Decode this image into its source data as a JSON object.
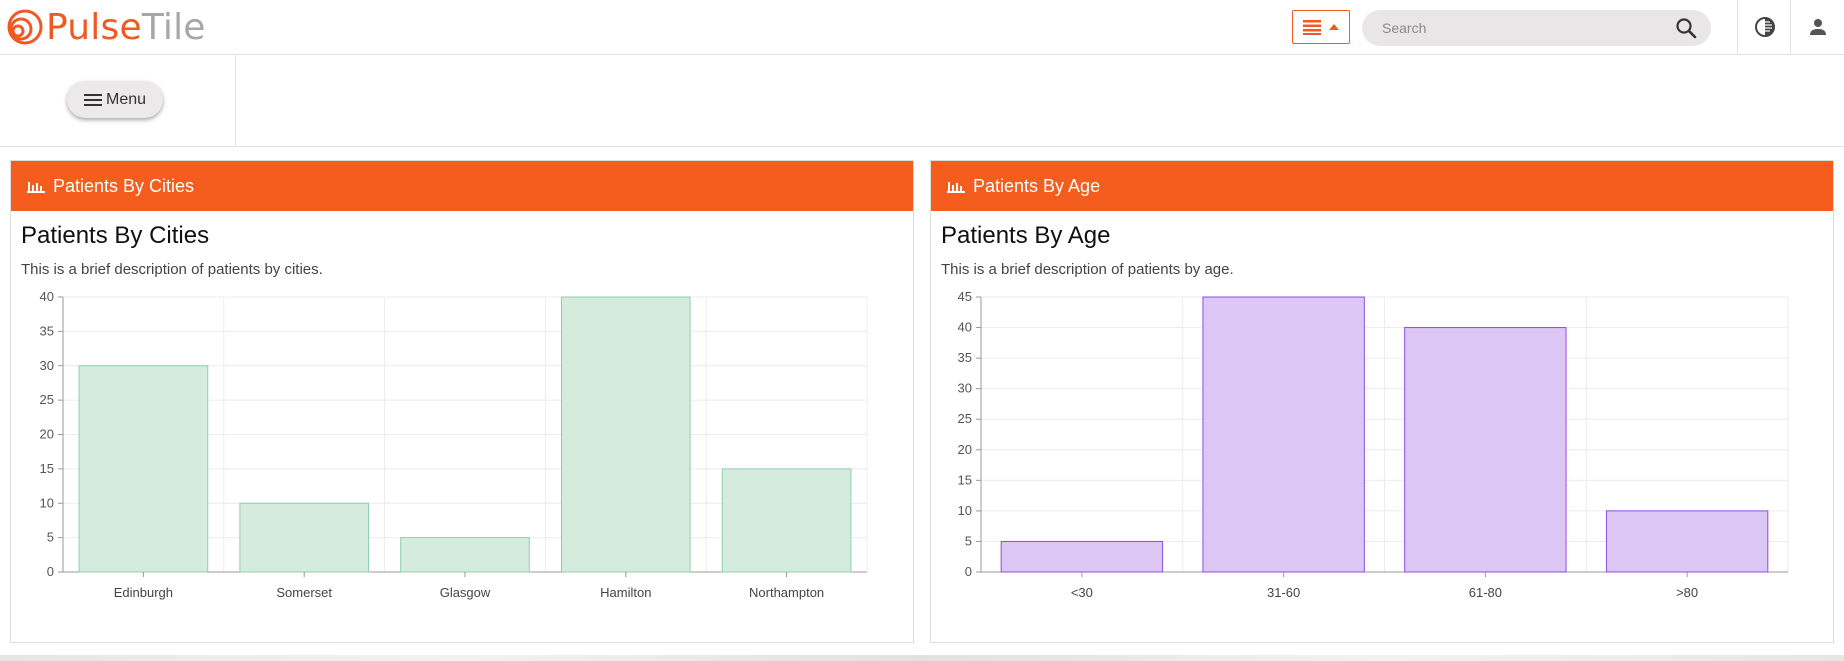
{
  "header": {
    "logo_text_1": "Pulse",
    "logo_text_2": "Tile",
    "search_placeholder": "Search",
    "nav_toggle_icon": "list-icon",
    "theme_icon": "contrast-icon",
    "user_icon": "person-icon"
  },
  "subbar": {
    "menu_label": "Menu"
  },
  "colors": {
    "brand": "#f05a22",
    "panel_header": "#f55d1f",
    "cities_bar_fill": "#d4ebde",
    "cities_bar_stroke": "#8fd0ad",
    "age_bar_fill": "#dcc7f4",
    "age_bar_stroke": "#8c4ee0"
  },
  "panels": [
    {
      "header": "Patients By Cities",
      "title": "Patients By Cities",
      "description": "This is a brief description of patients by cities."
    },
    {
      "header": "Patients By Age",
      "title": "Patients By Age",
      "description": "This is a brief description of patients by age."
    }
  ],
  "chart_data": [
    {
      "type": "bar",
      "title": "Patients By Cities",
      "categories": [
        "Edinburgh",
        "Somerset",
        "Glasgow",
        "Hamilton",
        "Northampton"
      ],
      "values": [
        30,
        10,
        5,
        40,
        15
      ],
      "ylim": [
        0,
        40
      ],
      "yticks": [
        0,
        5,
        10,
        15,
        20,
        25,
        30,
        35,
        40
      ],
      "grid": true,
      "legend": "none"
    },
    {
      "type": "bar",
      "title": "Patients By Age",
      "categories": [
        "<30",
        "31-60",
        "61-80",
        ">80"
      ],
      "values": [
        5,
        45,
        40,
        10
      ],
      "ylim": [
        0,
        45
      ],
      "yticks": [
        0,
        5,
        10,
        15,
        20,
        25,
        30,
        35,
        40,
        45
      ],
      "grid": true,
      "legend": "none"
    }
  ]
}
